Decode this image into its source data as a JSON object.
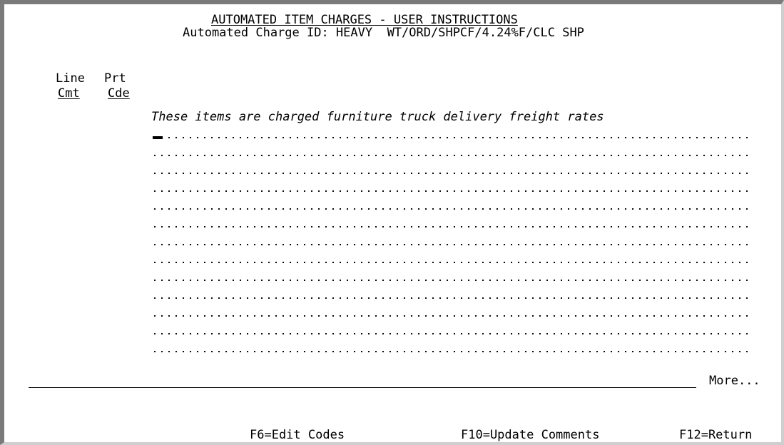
{
  "screen": {
    "title": "AUTOMATED ITEM CHARGES - USER INSTRUCTIONS",
    "subtitle": "Automated Charge ID: HEAVY  WT/ORD/SHPCF/4.24%F/CLC SHP"
  },
  "columns": {
    "line_label": "Line",
    "prt_label": "Prt",
    "cmt_label": "Cmt",
    "cde_label": "Cde"
  },
  "comments": {
    "first_line": "These items are charged furniture truck delivery freight rates",
    "empty_rows": 13
  },
  "footer": {
    "more_label": "More...",
    "f6_label": "F6=Edit Codes",
    "f10_label": "F10=Update Comments",
    "f12_label": "F12=Return"
  },
  "colors": {
    "background": "#ffffff",
    "text": "#000000",
    "frame_dark": "#7a7a7a",
    "frame_light": "#cfcfcf"
  }
}
